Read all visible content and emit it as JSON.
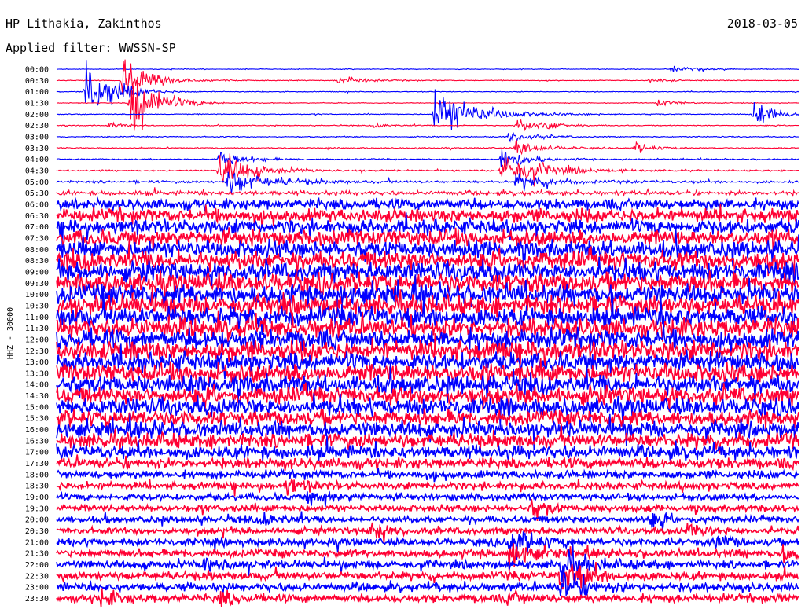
{
  "chart_data": {
    "type": "line",
    "title": "HP Lithakia, Zakinthos",
    "subtitle": "Applied filter: WWSSN-SP",
    "date": "2018-03-05",
    "ylabel": "HHZ - 30000",
    "xlabel": "",
    "series_colors": [
      "#0000ff",
      "#ff0033"
    ],
    "traces": [
      {
        "label": "00:00",
        "noise": 0.6,
        "events": [
          {
            "t": 0.83,
            "amp": 6,
            "dur": 0.02
          }
        ]
      },
      {
        "label": "00:30",
        "noise": 0.6,
        "events": [
          {
            "t": 0.09,
            "amp": 45,
            "dur": 0.03
          },
          {
            "t": 0.38,
            "amp": 8,
            "dur": 0.03
          },
          {
            "t": 0.8,
            "amp": 4,
            "dur": 0.02
          }
        ]
      },
      {
        "label": "01:00",
        "noise": 0.6,
        "events": [
          {
            "t": 0.04,
            "amp": 60,
            "dur": 0.03
          }
        ]
      },
      {
        "label": "01:30",
        "noise": 0.6,
        "events": [
          {
            "t": 0.1,
            "amp": 70,
            "dur": 0.03
          },
          {
            "t": 0.81,
            "amp": 6,
            "dur": 0.02
          }
        ]
      },
      {
        "label": "02:00",
        "noise": 0.7,
        "events": [
          {
            "t": 0.51,
            "amp": 40,
            "dur": 0.05
          },
          {
            "t": 0.94,
            "amp": 18,
            "dur": 0.03
          }
        ]
      },
      {
        "label": "02:30",
        "noise": 0.7,
        "events": [
          {
            "t": 0.07,
            "amp": 5,
            "dur": 0.02
          },
          {
            "t": 0.43,
            "amp": 4,
            "dur": 0.02
          },
          {
            "t": 0.62,
            "amp": 10,
            "dur": 0.03
          },
          {
            "t": 0.66,
            "amp": 6,
            "dur": 0.02
          }
        ]
      },
      {
        "label": "03:00",
        "noise": 0.8,
        "events": [
          {
            "t": 0.61,
            "amp": 10,
            "dur": 0.03
          }
        ]
      },
      {
        "label": "03:30",
        "noise": 0.9,
        "events": [
          {
            "t": 0.62,
            "amp": 14,
            "dur": 0.03
          },
          {
            "t": 0.78,
            "amp": 8,
            "dur": 0.02
          }
        ]
      },
      {
        "label": "04:00",
        "noise": 1.0,
        "events": [
          {
            "t": 0.22,
            "amp": 14,
            "dur": 0.03
          },
          {
            "t": 0.6,
            "amp": 20,
            "dur": 0.03
          }
        ]
      },
      {
        "label": "04:30",
        "noise": 1.2,
        "events": [
          {
            "t": 0.22,
            "amp": 30,
            "dur": 0.04
          },
          {
            "t": 0.6,
            "amp": 30,
            "dur": 0.05
          }
        ]
      },
      {
        "label": "05:00",
        "noise": 2.0,
        "events": [
          {
            "t": 0.23,
            "amp": 20,
            "dur": 0.05
          },
          {
            "t": 0.62,
            "amp": 12,
            "dur": 0.04
          }
        ]
      },
      {
        "label": "05:30",
        "noise": 3.5,
        "events": []
      },
      {
        "label": "06:00",
        "noise": 8,
        "events": []
      },
      {
        "label": "06:30",
        "noise": 10,
        "events": []
      },
      {
        "label": "07:00",
        "noise": 11,
        "events": []
      },
      {
        "label": "07:30",
        "noise": 12,
        "events": []
      },
      {
        "label": "08:00",
        "noise": 13,
        "events": []
      },
      {
        "label": "08:30",
        "noise": 14,
        "events": []
      },
      {
        "label": "09:00",
        "noise": 14,
        "events": []
      },
      {
        "label": "09:30",
        "noise": 15,
        "events": []
      },
      {
        "label": "10:00",
        "noise": 15,
        "events": []
      },
      {
        "label": "10:30",
        "noise": 15,
        "events": []
      },
      {
        "label": "11:00",
        "noise": 15,
        "events": []
      },
      {
        "label": "11:30",
        "noise": 15,
        "events": []
      },
      {
        "label": "12:00",
        "noise": 15,
        "events": []
      },
      {
        "label": "12:30",
        "noise": 15,
        "events": []
      },
      {
        "label": "13:00",
        "noise": 14,
        "events": []
      },
      {
        "label": "13:30",
        "noise": 14,
        "events": []
      },
      {
        "label": "14:00",
        "noise": 14,
        "events": []
      },
      {
        "label": "14:30",
        "noise": 13,
        "events": []
      },
      {
        "label": "15:00",
        "noise": 13,
        "events": []
      },
      {
        "label": "15:30",
        "noise": 12,
        "events": []
      },
      {
        "label": "16:00",
        "noise": 12,
        "events": []
      },
      {
        "label": "16:30",
        "noise": 11,
        "events": []
      },
      {
        "label": "17:00",
        "noise": 10,
        "events": []
      },
      {
        "label": "17:30",
        "noise": 8,
        "events": []
      },
      {
        "label": "18:00",
        "noise": 6,
        "events": []
      },
      {
        "label": "18:30",
        "noise": 5.5,
        "events": [
          {
            "t": 0.31,
            "amp": 14,
            "dur": 0.02
          }
        ]
      },
      {
        "label": "19:00",
        "noise": 5,
        "events": [
          {
            "t": 0.34,
            "amp": 12,
            "dur": 0.02
          }
        ]
      },
      {
        "label": "19:30",
        "noise": 5,
        "events": [
          {
            "t": 0.64,
            "amp": 12,
            "dur": 0.02
          }
        ]
      },
      {
        "label": "20:00",
        "noise": 5,
        "events": [
          {
            "t": 0.28,
            "amp": 10,
            "dur": 0.02
          },
          {
            "t": 0.8,
            "amp": 10,
            "dur": 0.02
          }
        ]
      },
      {
        "label": "20:30",
        "noise": 5,
        "events": [
          {
            "t": 0.42,
            "amp": 14,
            "dur": 0.02
          },
          {
            "t": 0.85,
            "amp": 10,
            "dur": 0.02
          }
        ]
      },
      {
        "label": "21:00",
        "noise": 5.5,
        "events": [
          {
            "t": 0.61,
            "amp": 20,
            "dur": 0.03
          },
          {
            "t": 0.89,
            "amp": 12,
            "dur": 0.02
          }
        ]
      },
      {
        "label": "21:30",
        "noise": 6,
        "events": [
          {
            "t": 0.61,
            "amp": 16,
            "dur": 0.03
          },
          {
            "t": 0.98,
            "amp": 12,
            "dur": 0.02
          }
        ]
      },
      {
        "label": "22:00",
        "noise": 6,
        "events": [
          {
            "t": 0.2,
            "amp": 14,
            "dur": 0.02
          },
          {
            "t": 0.68,
            "amp": 24,
            "dur": 0.03
          }
        ]
      },
      {
        "label": "22:30",
        "noise": 6,
        "events": [
          {
            "t": 0.68,
            "amp": 28,
            "dur": 0.03
          }
        ]
      },
      {
        "label": "23:00",
        "noise": 6,
        "events": [
          {
            "t": 0.68,
            "amp": 22,
            "dur": 0.03
          }
        ]
      },
      {
        "label": "23:30",
        "noise": 6,
        "events": [
          {
            "t": 0.06,
            "amp": 12,
            "dur": 0.02
          },
          {
            "t": 0.22,
            "amp": 10,
            "dur": 0.02
          },
          {
            "t": 0.61,
            "amp": 10,
            "dur": 0.02
          }
        ]
      }
    ]
  }
}
